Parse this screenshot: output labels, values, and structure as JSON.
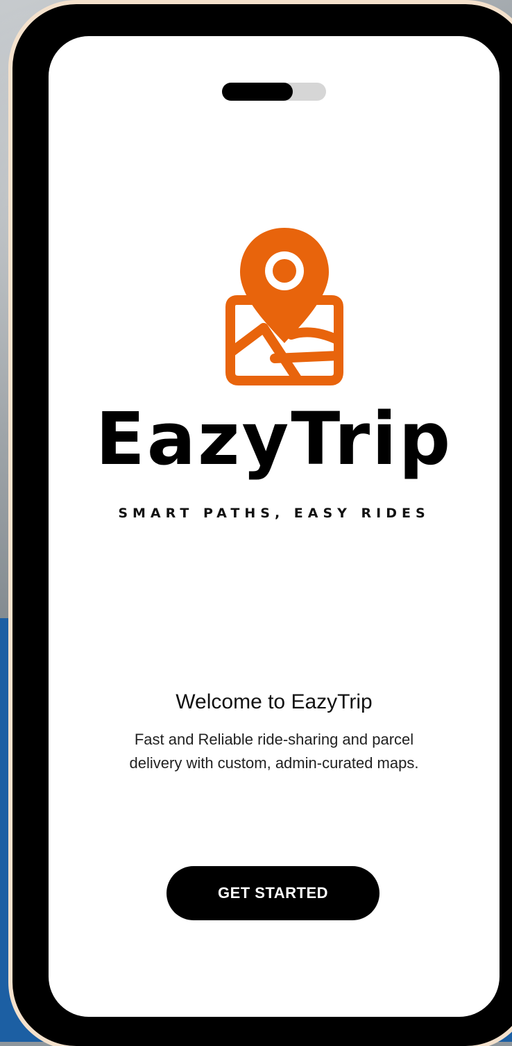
{
  "brand": {
    "name": "EazyTrip",
    "tagline": "SMART PATHS, EASY RIDES",
    "accent_color": "#e8640c",
    "logo_icon": "map-pin-icon"
  },
  "onboarding": {
    "page_indicator": {
      "current": 1,
      "total": 2
    },
    "title": "Welcome to EazyTrip",
    "description": "Fast and  Reliable ride-sharing and parcel delivery with custom, admin-curated maps.",
    "cta_label": "GET STARTED"
  }
}
